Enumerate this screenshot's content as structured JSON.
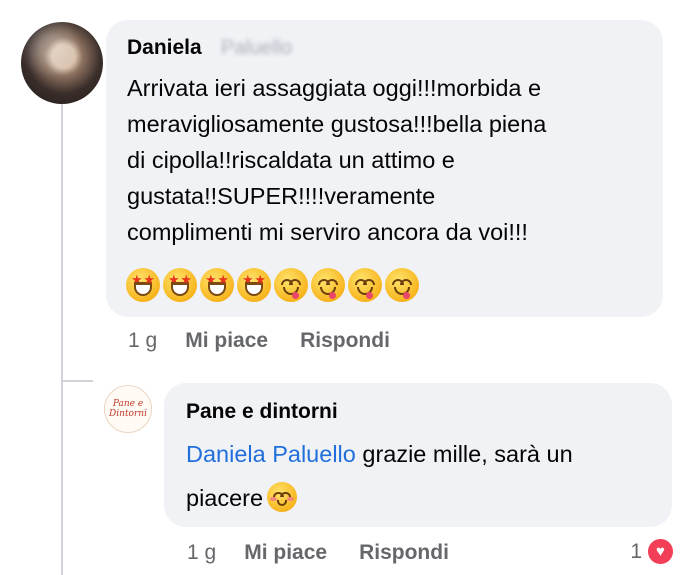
{
  "comment": {
    "author_first": "Daniela",
    "author_last_blurred": "Paluello",
    "lines": [
      "Arrivata ieri assaggiata oggi!!!morbida e",
      "meravigliosamente gustosa!!!bella piena",
      "di cipolla!!riscaldata un attimo e",
      "gustata!!SUPER!!!!veramente",
      "complimenti mi serviro ancora da voi!!!"
    ],
    "emojis": [
      "star-struck-icon",
      "star-struck-icon",
      "star-struck-icon",
      "star-struck-icon",
      "yum-face-icon",
      "yum-face-icon",
      "yum-face-icon",
      "yum-face-icon"
    ],
    "time": "1 g",
    "like_label": "Mi piace",
    "reply_label": "Rispondi"
  },
  "reply": {
    "author": "Pane e dintorni",
    "avatar_text": [
      "Pane e",
      "Dintorni"
    ],
    "mention": "Daniela Paluello",
    "text_after_mention": " grazie mille, sarà un",
    "line2": "piacere",
    "emoji": "smiling-face-icon",
    "time": "1 g",
    "like_label": "Mi piace",
    "reply_label": "Rispondi",
    "reaction_count": "1",
    "reaction_icon": "heart-icon"
  },
  "colors": {
    "bubble": "#f0f2f5",
    "mention": "#216fdb",
    "meta": "#65676b",
    "heart": "#f33e58"
  }
}
